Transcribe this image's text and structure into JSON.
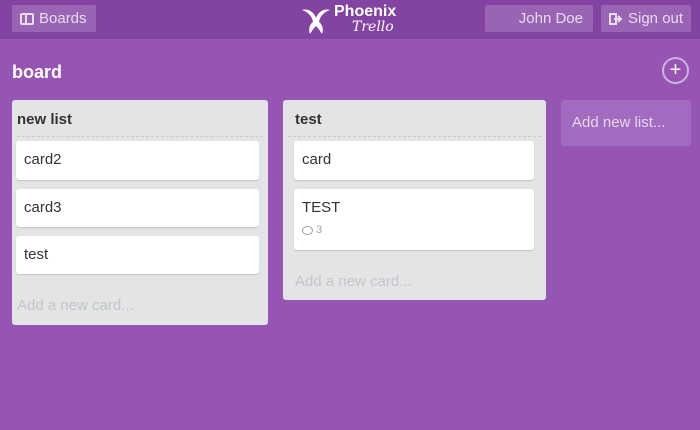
{
  "header": {
    "boards_label": "Boards",
    "logo_line1": "Phoenix",
    "logo_line2": "Trello",
    "user_name": "John Doe",
    "signout_label": "Sign out"
  },
  "board": {
    "title": "board",
    "add_icon": "+"
  },
  "lists": [
    {
      "title": "new list",
      "cards": [
        {
          "text": "card2"
        },
        {
          "text": "card3"
        },
        {
          "text": "test"
        }
      ],
      "add_card_placeholder": "Add a new card..."
    },
    {
      "title": "test",
      "cards": [
        {
          "text": "card"
        },
        {
          "text": "TEST",
          "comments": "3"
        }
      ],
      "add_card_placeholder": "Add a new card..."
    }
  ],
  "add_list_placeholder": "Add new list...",
  "colors": {
    "background": "#9655b3",
    "topbar": "#8243a3",
    "list": "#e2e4e6"
  }
}
